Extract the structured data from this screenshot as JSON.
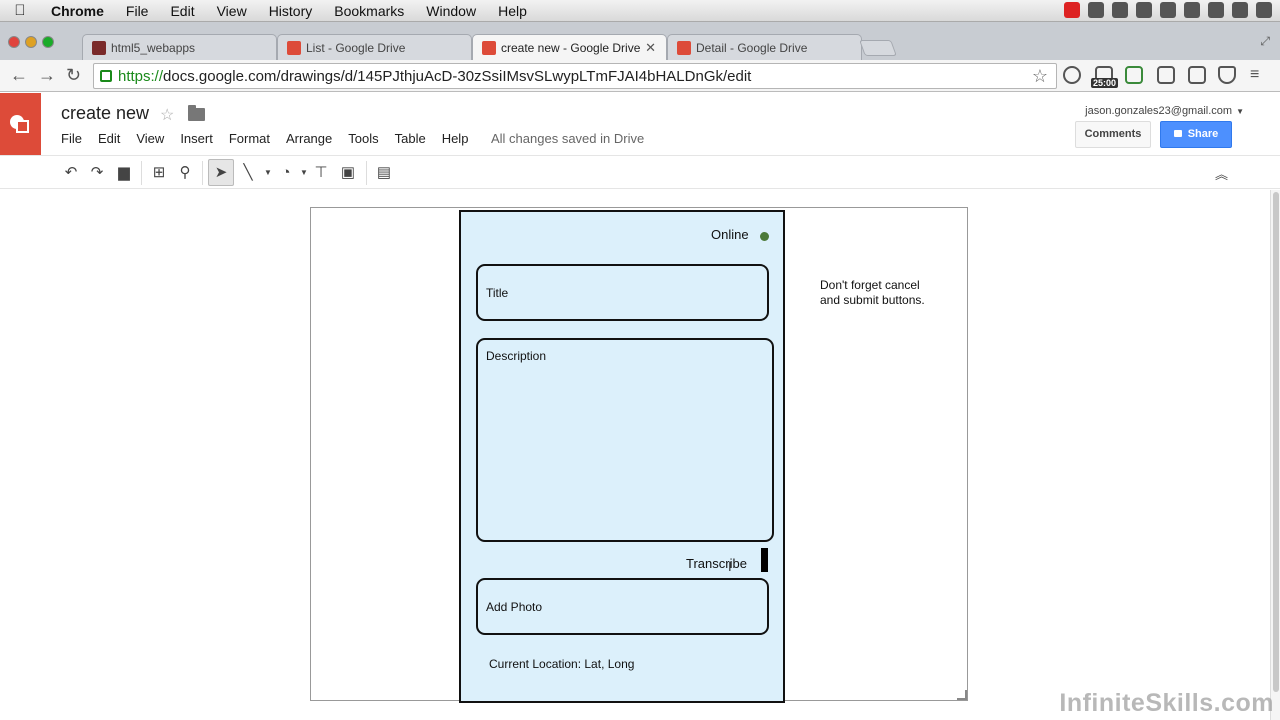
{
  "os_menubar": {
    "app_name": "Chrome",
    "items": [
      "File",
      "Edit",
      "View",
      "History",
      "Bookmarks",
      "Window",
      "Help"
    ]
  },
  "browser": {
    "tabs": [
      {
        "label": "html5_webapps",
        "active": false
      },
      {
        "label": "List - Google Drive",
        "active": false
      },
      {
        "label": "create new - Google Drive",
        "active": true
      },
      {
        "label": "Detail - Google Drive",
        "active": false
      }
    ],
    "url_scheme": "https://",
    "url_rest": "docs.google.com/drawings/d/145PJthjuAcD-30zSsiIMsvSLwypLTmFJAI4bHALDnGk/edit",
    "timer_badge": "25:00"
  },
  "app": {
    "doc_title": "create new",
    "menu": [
      "File",
      "Edit",
      "View",
      "Insert",
      "Format",
      "Arrange",
      "Tools",
      "Table",
      "Help"
    ],
    "save_status": "All changes saved in Drive",
    "account": "jason.gonzales23@gmail.com",
    "comments_label": "Comments",
    "share_label": "Share",
    "accent_red": "#dd4b39",
    "share_blue": "#4d90fe"
  },
  "drawing": {
    "online_label": "Online",
    "online_color": "#4c7a3a",
    "title_field": "Title",
    "description_field": "Description",
    "transcribe_label": "Transcribe",
    "add_photo_field": "Add Photo",
    "location_text": "Current Location: Lat, Long",
    "note_line1": "Don't forget cancel",
    "note_line2": "and submit buttons.",
    "phone_fill": "#dcf0fb"
  },
  "watermark": "InfiniteSkills.com"
}
